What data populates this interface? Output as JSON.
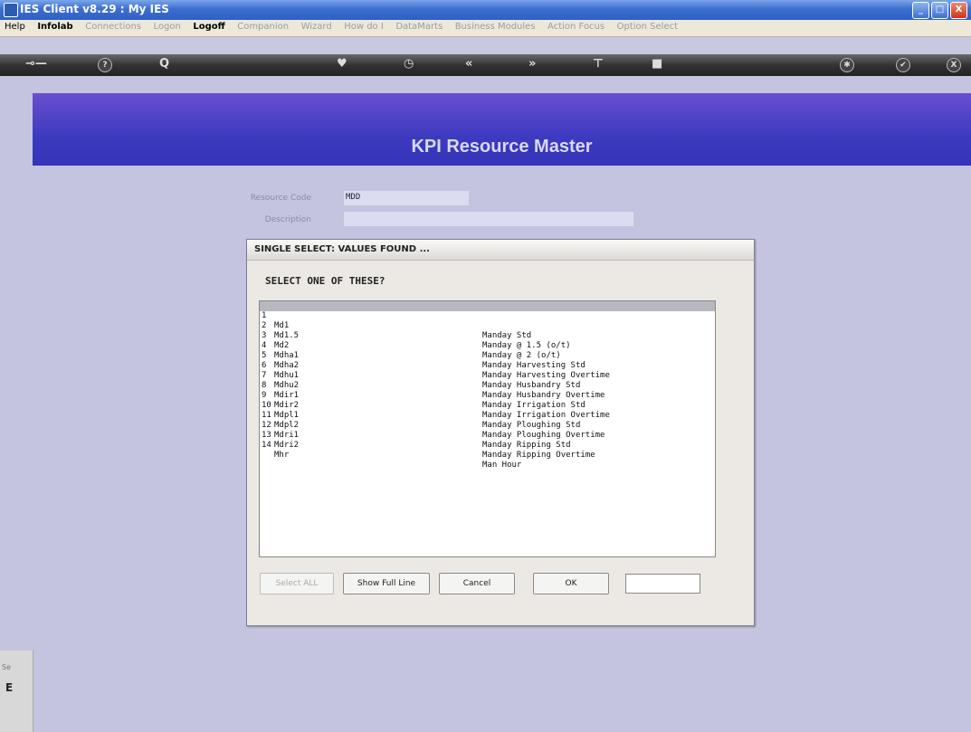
{
  "window": {
    "title": "IES Client v8.29 : My IES",
    "minimize": "_",
    "maximize": "□",
    "close": "X"
  },
  "menu": [
    {
      "label": "Help",
      "state": "active"
    },
    {
      "label": "Infolab",
      "state": "bold"
    },
    {
      "label": "Connections",
      "state": "dim"
    },
    {
      "label": "Logon",
      "state": "dim"
    },
    {
      "label": "Logoff",
      "state": "bold"
    },
    {
      "label": "Companion",
      "state": "dim"
    },
    {
      "label": "Wizard",
      "state": "dim"
    },
    {
      "label": "How do I",
      "state": "dim"
    },
    {
      "label": "DataMarts",
      "state": "dim"
    },
    {
      "label": "Business Modules",
      "state": "dim"
    },
    {
      "label": "Action Focus",
      "state": "dim"
    },
    {
      "label": "Option Select",
      "state": "dim"
    }
  ],
  "toolbar": {
    "key": "⊸—",
    "help": "?",
    "search": "Q",
    "heart": "♥",
    "clock": "◷",
    "prev": "«",
    "next": "»",
    "tree": "⊤",
    "stop": "■",
    "settings": "✱",
    "check": "✔",
    "close": "X"
  },
  "banner": {
    "title": "KPI Resource Master"
  },
  "form": {
    "resource_code_label": "Resource Code",
    "resource_code_value": "MDD",
    "description_label": "Description",
    "description_value": ""
  },
  "dialog": {
    "title": "SINGLE SELECT: VALUES FOUND ...",
    "prompt": "SELECT ONE OF THESE?",
    "rows": [
      {
        "num": "1",
        "code": "Md1",
        "desc": "Manday Std",
        "selected": true
      },
      {
        "num": "2",
        "code": "Md1.5",
        "desc": "Manday @ 1.5 (o/t)"
      },
      {
        "num": "3",
        "code": "Md2",
        "desc": "Manday @ 2 (o/t)"
      },
      {
        "num": "4",
        "code": "Mdha1",
        "desc": "Manday Harvesting Std"
      },
      {
        "num": "5",
        "code": "Mdha2",
        "desc": "Manday Harvesting Overtime"
      },
      {
        "num": "6",
        "code": "Mdhu1",
        "desc": "Manday Husbandry Std"
      },
      {
        "num": "7",
        "code": "Mdhu2",
        "desc": "Manday Husbandry Overtime"
      },
      {
        "num": "8",
        "code": "Mdir1",
        "desc": "Manday Irrigation Std"
      },
      {
        "num": "9",
        "code": "Mdir2",
        "desc": "Manday Irrigation Overtime"
      },
      {
        "num": "10",
        "code": "Mdpl1",
        "desc": "Manday Ploughing Std"
      },
      {
        "num": "11",
        "code": "Mdpl2",
        "desc": "Manday Ploughing Overtime"
      },
      {
        "num": "12",
        "code": "Mdri1",
        "desc": "Manday Ripping Std"
      },
      {
        "num": "13",
        "code": "Mdri2",
        "desc": "Manday Ripping Overtime"
      },
      {
        "num": "14",
        "code": "Mhr",
        "desc": "Man Hour"
      }
    ],
    "buttons": {
      "select_all": "Select ALL",
      "show_full_line": "Show Full Line",
      "cancel": "Cancel",
      "ok": "OK"
    },
    "input_value": ""
  },
  "status": {
    "label": "Se",
    "value": "E"
  }
}
